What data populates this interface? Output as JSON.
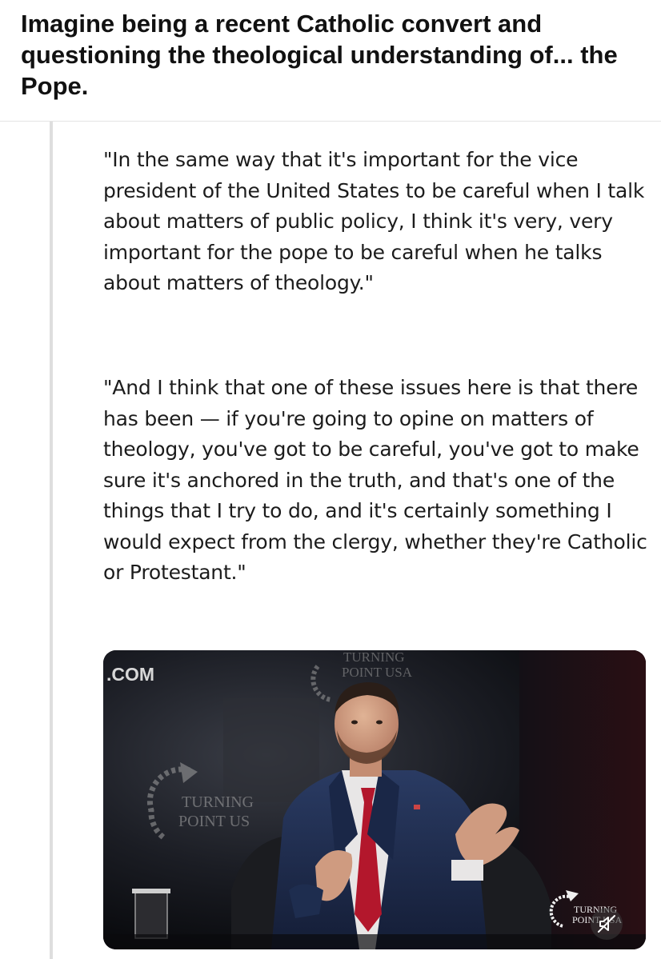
{
  "post": {
    "title": "Imagine being a recent Catholic convert and questioning the theological understanding of... the Pope."
  },
  "quote": {
    "paragraphs": [
      "\"In the same way that it's important for the vice president of the United States to be careful when I talk about matters of public policy, I think it's very, very important for the pope to be careful when he talks about matters of theology.\"",
      "\"And I think that one of these issues here is that there has been — if you're going to opine on matters of theology, you've got to be careful, you've got to make sure it's anchored in the truth, and that's one of the things that I try to do, and it's certainly something I would expect from the clergy, whether they're Catholic or Protestant.\""
    ]
  },
  "video": {
    "watermarks": {
      "top_left": ".COM",
      "backdrop_top_line1": "TURNING",
      "backdrop_top_line2": "POINT USA",
      "backdrop_left_line1": "TURNING",
      "backdrop_left_line2": "POINT US",
      "corner_line1": "TURNING",
      "corner_line2": "POINT USA"
    },
    "mute_icon": "speaker-muted-icon"
  },
  "colors": {
    "quote_rule": "#dedede",
    "video_bg": "#0d0f14",
    "suit": "#1e2d4f",
    "tie": "#b3172c"
  }
}
